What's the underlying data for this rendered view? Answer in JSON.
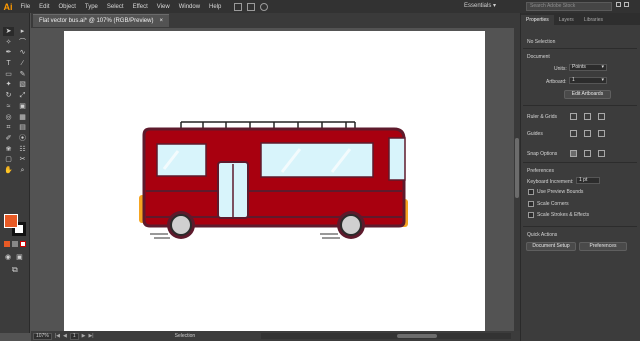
{
  "app": {
    "logo": "Ai"
  },
  "menu": [
    "File",
    "Edit",
    "Object",
    "Type",
    "Select",
    "Effect",
    "View",
    "Window",
    "Help"
  ],
  "workspace": {
    "label": "Essentials"
  },
  "stock_search": {
    "placeholder": "Search Adobe Stock"
  },
  "document": {
    "tab_title": "Flat vector bus.ai* @ 107% (RGB/Preview)",
    "close": "×"
  },
  "status": {
    "zoom": "107%",
    "page": "1",
    "tool_name": "Selection"
  },
  "colors": {
    "fill": "#e85a25",
    "stroke": "#111111",
    "bus_body": "#a8000f",
    "bus_outline": "#5e1a2c",
    "window": "#d8f4fb",
    "wheel": "#d0d0d0"
  },
  "panel": {
    "tabs": [
      "Properties",
      "Layers",
      "Libraries"
    ],
    "selection_label": "No Selection",
    "document_heading": "Document",
    "units_label": "Units:",
    "units_value": "Points",
    "artboard_label": "Artboard:",
    "artboard_value": "1",
    "edit_artboards": "Edit Artboards",
    "rulers_grids": "Ruler & Grids",
    "guides": "Guides",
    "snap_options": "Snap Options",
    "preferences_heading": "Preferences",
    "keyboard_increment_label": "Keyboard Increment:",
    "keyboard_increment_value": "1 pt",
    "use_preview_bounds": "Use Preview Bounds",
    "scale_corners": "Scale Corners",
    "scale_strokes": "Scale Strokes & Effects",
    "quick_actions": "Quick Actions",
    "document_setup": "Document Setup",
    "preferences_button": "Preferences"
  }
}
